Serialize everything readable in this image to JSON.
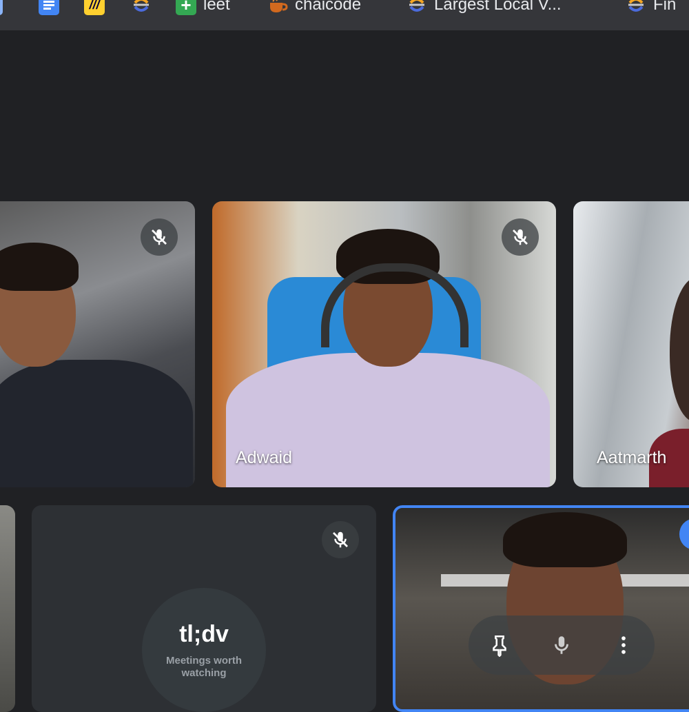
{
  "bookmarks": [
    {
      "label": "",
      "icon": "google-docs-icon"
    },
    {
      "label": "",
      "icon": "miro-icon"
    },
    {
      "label": "",
      "icon": "loop-icon"
    },
    {
      "label": "leet",
      "icon": "google-sheets-icon"
    },
    {
      "label": "chaicode",
      "icon": "tea-cup-icon"
    },
    {
      "label": "Largest Local V...",
      "icon": "loop-icon"
    },
    {
      "label": "Fin",
      "icon": "loop-icon"
    }
  ],
  "participants": [
    {
      "name": "",
      "muted": true
    },
    {
      "name": "Adwaid",
      "muted": true
    },
    {
      "name": "Aatmarth",
      "muted": false
    },
    {
      "name": "",
      "muted": false
    },
    {
      "name": "",
      "muted": true
    },
    {
      "name": "",
      "muted": false,
      "active_speaker": true
    }
  ],
  "tldv": {
    "logo": "tl;dv",
    "tagline_line1": "Meetings worth",
    "tagline_line2": "watching"
  },
  "colors": {
    "background": "#202124",
    "bookmarks_bar": "#35363a",
    "active_speaker_border": "#4285f4"
  }
}
